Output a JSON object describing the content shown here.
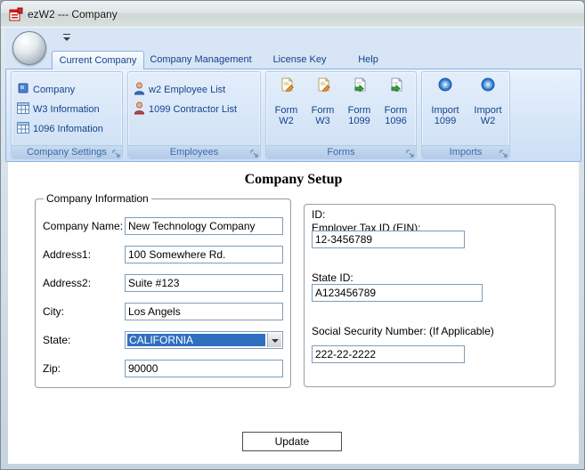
{
  "window": {
    "title": "ezW2 --- Company"
  },
  "icons": {
    "app_icon": "red-w2-form-icon",
    "qat_customize": "dropdown-arrow",
    "combo_arrow": "down-triangle",
    "dialog_launcher": "corner-arrow"
  },
  "ribbon": {
    "tabs": [
      {
        "label": "Current Company"
      },
      {
        "label": "Company Management"
      },
      {
        "label": "License Key"
      },
      {
        "label": "Help"
      }
    ],
    "groups": {
      "company_settings": {
        "caption": "Company Settings",
        "items": [
          {
            "label": "Company"
          },
          {
            "label": "W3 Information"
          },
          {
            "label": "1096 Infomation"
          }
        ]
      },
      "employees": {
        "caption": "Employees",
        "items": [
          {
            "label": "w2 Employee List"
          },
          {
            "label": "1099 Contractor List"
          }
        ]
      },
      "forms": {
        "caption": "Forms",
        "items": [
          {
            "line1": "Form",
            "line2": "W2"
          },
          {
            "line1": "Form",
            "line2": "W3"
          },
          {
            "line1": "Form",
            "line2": "1099"
          },
          {
            "line1": "Form",
            "line2": "1096"
          }
        ]
      },
      "imports": {
        "caption": "Imports",
        "items": [
          {
            "line1": "Import",
            "line2": "1099"
          },
          {
            "line1": "Import",
            "line2": "W2"
          }
        ]
      }
    }
  },
  "main": {
    "heading": "Company Setup",
    "company_info": {
      "legend": "Company Information",
      "fields": [
        {
          "label": "Company Name:",
          "value": "New Technology Company"
        },
        {
          "label": "Address1:",
          "value": "100 Somewhere Rd."
        },
        {
          "label": "Address2:",
          "value": "Suite #123"
        },
        {
          "label": "City:",
          "value": "Los Angels"
        },
        {
          "label": "State:",
          "value": "CALIFORNIA"
        },
        {
          "label": "Zip:",
          "value": "90000"
        }
      ]
    },
    "id_info": {
      "title": "ID:",
      "fields": [
        {
          "label": "Employer Tax ID (EIN):",
          "value": "12-3456789"
        },
        {
          "label": "State ID:",
          "value": "A123456789"
        },
        {
          "label": "Social Security Number: (If Applicable)",
          "value": "222-22-2222"
        }
      ]
    },
    "update_button": "Update"
  }
}
